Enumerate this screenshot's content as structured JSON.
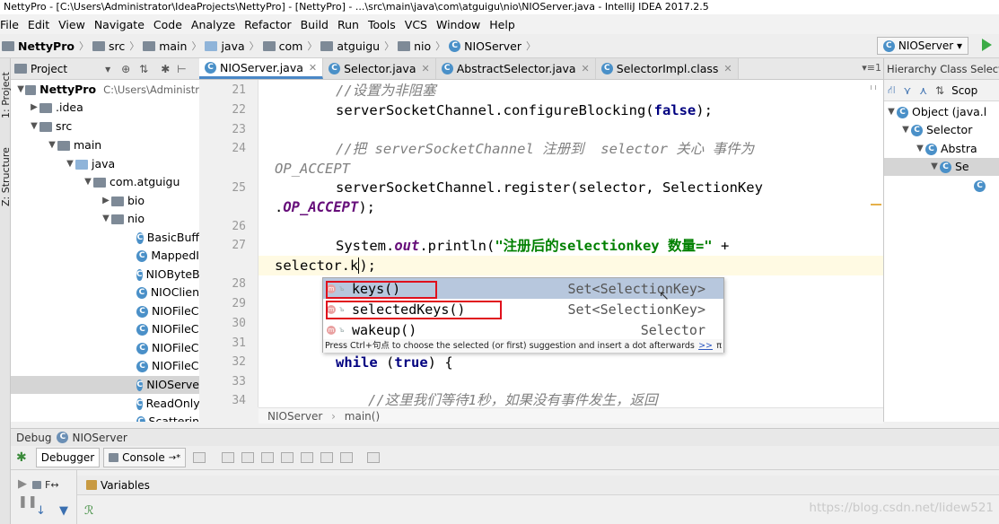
{
  "window": {
    "title": "NettyPro - [C:\\Users\\Administrator\\IdeaProjects\\NettyPro] - [NettyPro] - ...\\src\\main\\java\\com\\atguigu\\nio\\NIOServer.java - IntelliJ IDEA 2017.2.5"
  },
  "menu": [
    "File",
    "Edit",
    "View",
    "Navigate",
    "Code",
    "Analyze",
    "Refactor",
    "Build",
    "Run",
    "Tools",
    "VCS",
    "Window",
    "Help"
  ],
  "breadcrumb": [
    "NettyPro",
    "src",
    "main",
    "java",
    "com",
    "atguigu",
    "nio",
    "NIOServer"
  ],
  "run_config": "NIOServer",
  "side_tabs": {
    "project": "1: Project",
    "structure": "Z: Structure"
  },
  "project_panel": {
    "title": "Project",
    "root": "NettyPro",
    "root_path": "C:\\Users\\Administr",
    "items": {
      "idea": ".idea",
      "src": "src",
      "main": "main",
      "java": "java",
      "pkg": "com.atguigu",
      "bio": "bio",
      "nio": "nio"
    },
    "files": [
      "BasicBuff",
      "MappedI",
      "NIOByteB",
      "NIOClien",
      "NIOFileC",
      "NIOFileC",
      "NIOFileC",
      "NIOFileC",
      "NIOServe",
      "ReadOnly",
      "Scatterin"
    ]
  },
  "tabs": [
    {
      "label": "NIOServer.java"
    },
    {
      "label": "Selector.java"
    },
    {
      "label": "AbstractSelector.java"
    },
    {
      "label": "SelectorImpl.class"
    }
  ],
  "line_numbers": [
    "21",
    "22",
    "23",
    "24",
    "25",
    "26",
    "27",
    "28",
    "29",
    "30",
    "31",
    "32",
    "33",
    "34"
  ],
  "code": {
    "l21": "//设置为非阻塞",
    "l22_a": "serverSocketChannel.configureBlocking(",
    "l22_kw": "false",
    "l22_b": ");",
    "l24_a": "//把 serverSocketChannel 注册到  selector 关心 事件为",
    "l24_b": "OP_ACCEPT",
    "l25_a": "serverSocketChannel.register(selector, SelectionKey",
    "l25_dot": ".",
    "l25_fld": "OP_ACCEPT",
    "l25_end": ");",
    "l27_a": "System.",
    "l27_fld": "out",
    "l27_b": ".println(",
    "l27_str": "\"注册后的selectionkey 数量=\"",
    "l27_c": " +",
    "l27_cont": "selector.k",
    "l27_end": ");",
    "l32_kw": "while",
    "l32_a": " (",
    "l32_kw2": "true",
    "l32_b": ") {",
    "l34": "//这里我们等待1秒，如果没有事件发生，返回"
  },
  "completion": {
    "items": [
      {
        "name": "keys()",
        "type": "Set<SelectionKey>"
      },
      {
        "name": "selectedKeys()",
        "type": "Set<SelectionKey>"
      },
      {
        "name": "wakeup()",
        "type": "Selector"
      }
    ],
    "hint": "Press Ctrl+句点 to choose the selected (or first) suggestion and insert a dot afterwards",
    "hint_link": ">>",
    "hint_pi": "π"
  },
  "editor_breadcrumb": [
    "NIOServer",
    "main()"
  ],
  "hierarchy": {
    "title": "Hierarchy Class Selector",
    "scope": "Scop",
    "rows": [
      "Object (java.l",
      "Selector",
      "Abstra",
      "Se",
      ""
    ]
  },
  "debug": {
    "title": "Debug",
    "config": "NIOServer",
    "tabs": [
      "Debugger",
      "Console"
    ],
    "frames": "F",
    "variables": "Variables"
  },
  "watermark": "https://blog.csdn.net/lidew521"
}
